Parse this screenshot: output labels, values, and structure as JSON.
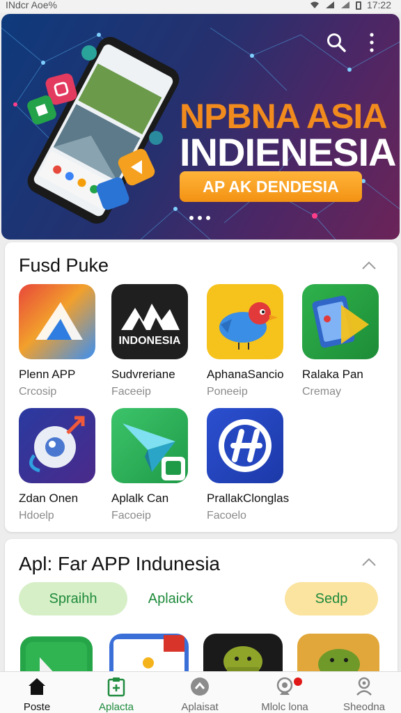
{
  "status_bar": {
    "carrier": "INdcr Aoe%",
    "time": "17:22"
  },
  "hero": {
    "title_line1": "NPBNA ASIA",
    "title_line2": "INDIENESIA",
    "cta_label": "AP AK DENDESIA",
    "colors": {
      "accent": "#f28b1e",
      "cta": "#f5a623"
    }
  },
  "section1": {
    "title": "Fusd Puke",
    "apps": [
      {
        "name": "Plenn APP",
        "subtitle": "Crcosip",
        "icon": "maps-triangle-icon"
      },
      {
        "name": "Sudvreriane",
        "subtitle": "Faceeip",
        "icon": "indonesia-mountain-icon",
        "icon_text": "INDONESIA"
      },
      {
        "name": "AphanaSancio",
        "subtitle": "Poneeip",
        "icon": "blue-bird-icon"
      },
      {
        "name": "Ralaka Pan",
        "subtitle": "Cremay",
        "icon": "tablet-play-icon"
      },
      {
        "name": "Zdan Onen",
        "subtitle": "Hdoelp",
        "icon": "eye-arrow-icon"
      },
      {
        "name": "Aplalk Can",
        "subtitle": "Facoeip",
        "icon": "paper-plane-icon"
      },
      {
        "name": "PrallakClonglas",
        "subtitle": "Facoelo",
        "icon": "h-circle-icon"
      }
    ]
  },
  "section2": {
    "title": "Apl: Far APP Indunesia",
    "chips": [
      "Spraihh",
      "Aplaick",
      "Sedp"
    ]
  },
  "bottom_nav": [
    {
      "label": "Poste",
      "icon": "home-icon"
    },
    {
      "label": "Aplacta",
      "icon": "clipboard-icon"
    },
    {
      "label": "Aplaisat",
      "icon": "chevron-circle-icon"
    },
    {
      "label": "Mlolc lona",
      "icon": "webcam-icon"
    },
    {
      "label": "Sheodna",
      "icon": "person-settings-icon"
    }
  ]
}
